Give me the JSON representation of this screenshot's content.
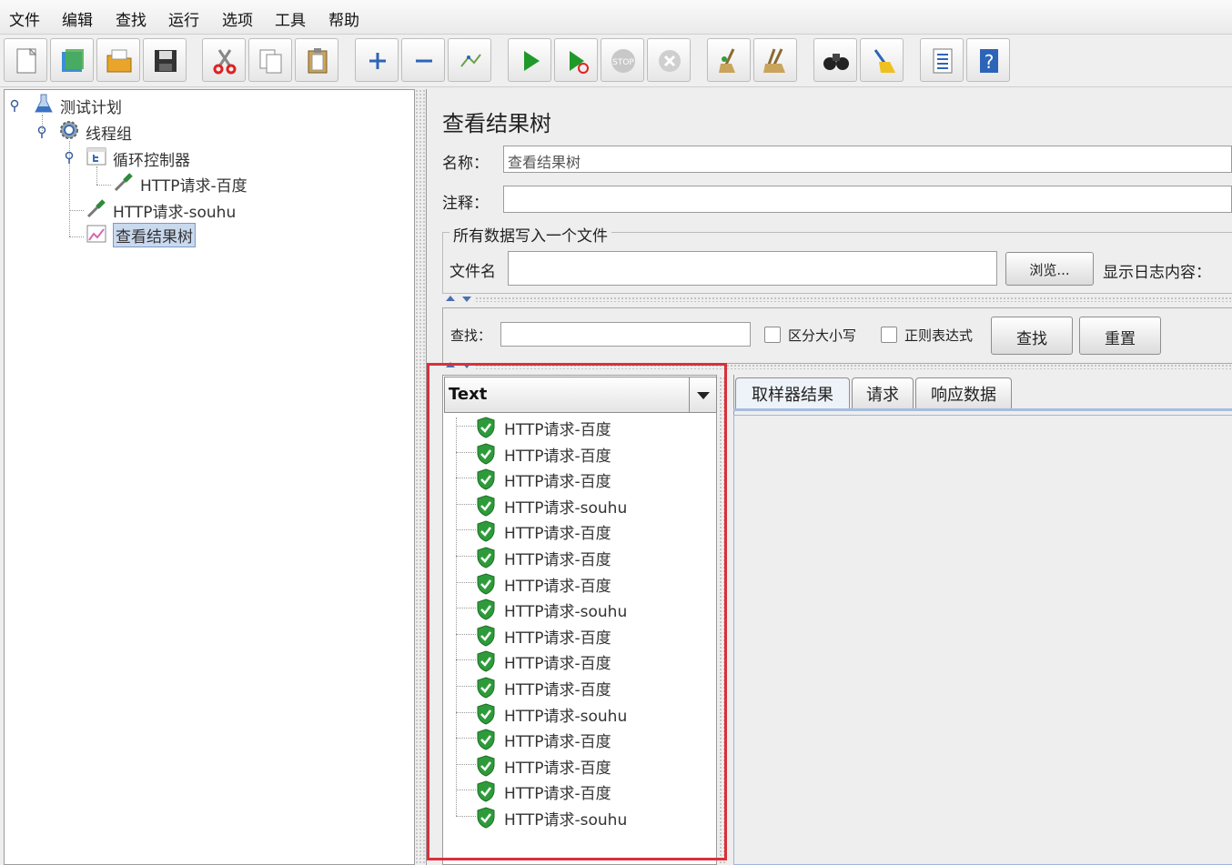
{
  "menu": [
    "文件",
    "编辑",
    "查找",
    "运行",
    "选项",
    "工具",
    "帮助"
  ],
  "toolbar_icons": [
    "new-icon",
    "templates-icon",
    "open-icon",
    "save-icon",
    "cut-icon",
    "copy-icon",
    "paste-icon",
    "expand-icon",
    "collapse-icon",
    "toggle-icon",
    "start-icon",
    "start-no-pause-icon",
    "stop-icon",
    "shutdown-icon",
    "clear-icon",
    "clear-all-icon",
    "search-icon",
    "reset-search-icon",
    "function-helper-icon",
    "help-icon"
  ],
  "tree": {
    "test_plan": "测试计划",
    "thread_group": "线程组",
    "loop_controller": "循环控制器",
    "http_baidu": "HTTP请求-百度",
    "http_souhu": "HTTP请求-souhu",
    "result_tree": "查看结果树"
  },
  "panel": {
    "title": "查看结果树",
    "name_label": "名称：",
    "name_value": "查看结果树",
    "comment_label": "注释：",
    "comment_value": "",
    "file_group_title": "所有数据写入一个文件",
    "filename_label": "文件名",
    "filename_value": "",
    "browse_button": "浏览...",
    "log_label": "显示日志内容："
  },
  "search": {
    "label": "查找：",
    "value": "",
    "case_sensitive": "区分大小写",
    "regex": "正则表达式",
    "find_button": "查找",
    "reset_button": "重置"
  },
  "renderer": "Text",
  "results": [
    "HTTP请求-百度",
    "HTTP请求-百度",
    "HTTP请求-百度",
    "HTTP请求-souhu",
    "HTTP请求-百度",
    "HTTP请求-百度",
    "HTTP请求-百度",
    "HTTP请求-souhu",
    "HTTP请求-百度",
    "HTTP请求-百度",
    "HTTP请求-百度",
    "HTTP请求-souhu",
    "HTTP请求-百度",
    "HTTP请求-百度",
    "HTTP请求-百度",
    "HTTP请求-souhu"
  ],
  "tabs": [
    "取样器结果",
    "请求",
    "响应数据"
  ],
  "colors": {
    "success": "#2e9b3a",
    "highlight": "#d9303a",
    "selection": "#c9d9ee"
  }
}
